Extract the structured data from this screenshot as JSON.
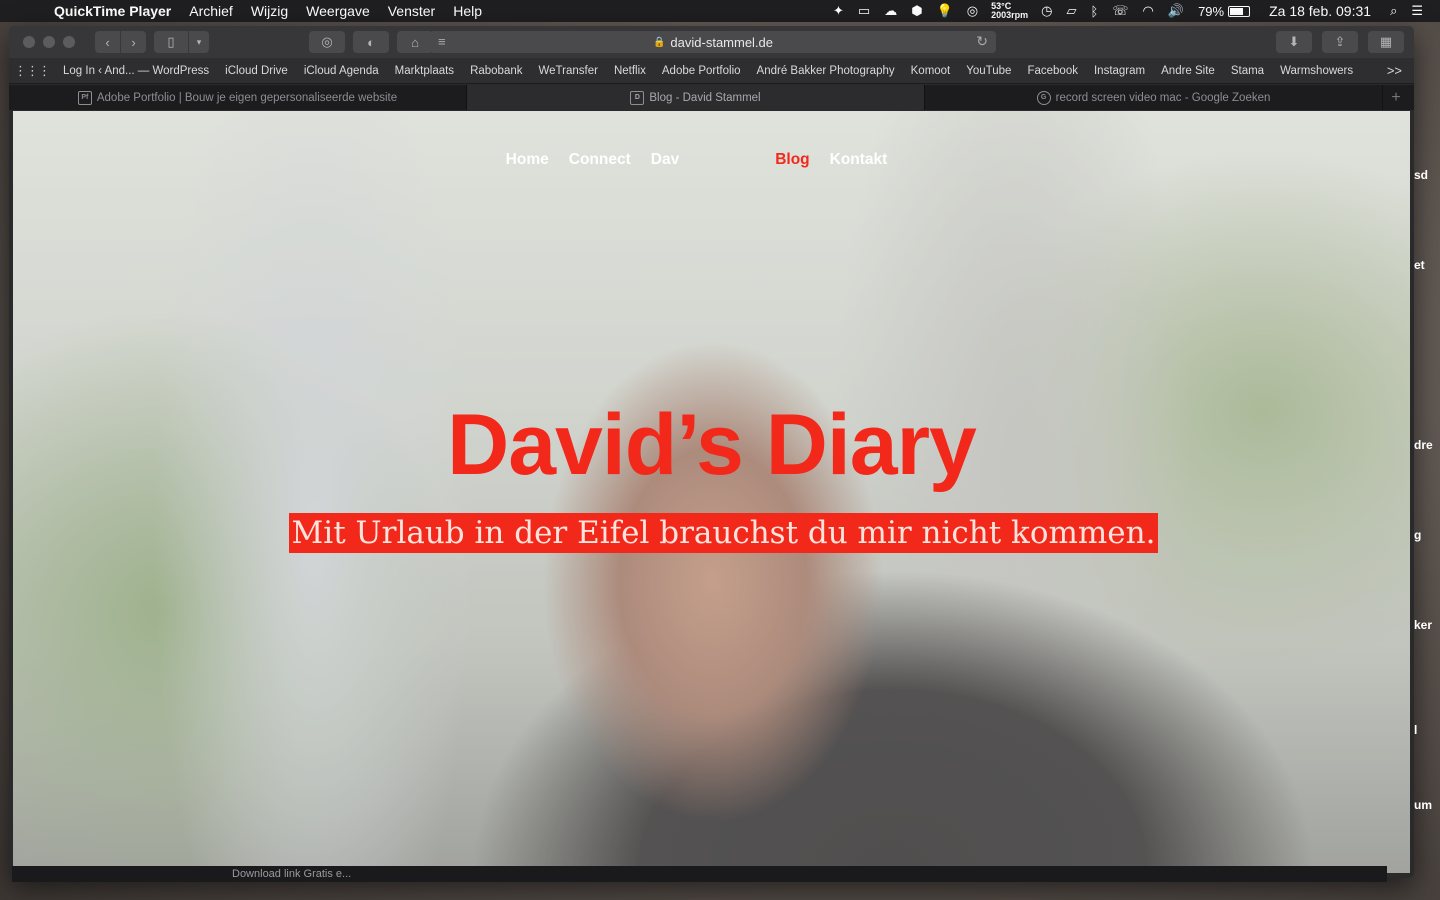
{
  "menubar": {
    "app_name": "QuickTime Player",
    "menus": [
      "Archief",
      "Wijzig",
      "Weergave",
      "Venster",
      "Help"
    ],
    "temperature": "53°C",
    "rpm": "2003rpm",
    "battery": "79%",
    "battery_level": 0.79,
    "datetime": "Za 18 feb. 09:31"
  },
  "browser": {
    "url": "david-stammel.de",
    "bookmarks": [
      "Log In ‹ And... — WordPress",
      "iCloud Drive",
      "iCloud Agenda",
      "Marktplaats",
      "Rabobank",
      "WeTransfer",
      "Netflix",
      "Adobe Portfolio",
      "André Bakker Photography",
      "Komoot",
      "YouTube",
      "Facebook",
      "Instagram",
      "Andre Site",
      "Stama",
      "Warmshowers"
    ],
    "bookmarks_more": ">>",
    "tabs": [
      {
        "favicon": "Pf",
        "title": "Adobe Portfolio | Bouw je eigen gepersonaliseerde website"
      },
      {
        "favicon": "D",
        "title": "Blog - David Stammel"
      },
      {
        "favicon": "G",
        "title": "record screen video mac - Google Zoeken"
      }
    ],
    "new_tab": "+"
  },
  "site": {
    "nav": [
      "Home",
      "Connect",
      "Dav",
      "Blog",
      "Kontakt"
    ],
    "active_nav": "Blog",
    "title": "David’s Diary",
    "subtitle": "Mit Urlaub in der Eifel brauchst du mir nicht kommen.",
    "accent_color": "#f2291a"
  },
  "background_window": {
    "status_text": "Download link Gratis e...",
    "edge_fragments": [
      "sd",
      "et",
      "dre",
      "g",
      "ker",
      "l",
      "um"
    ]
  }
}
